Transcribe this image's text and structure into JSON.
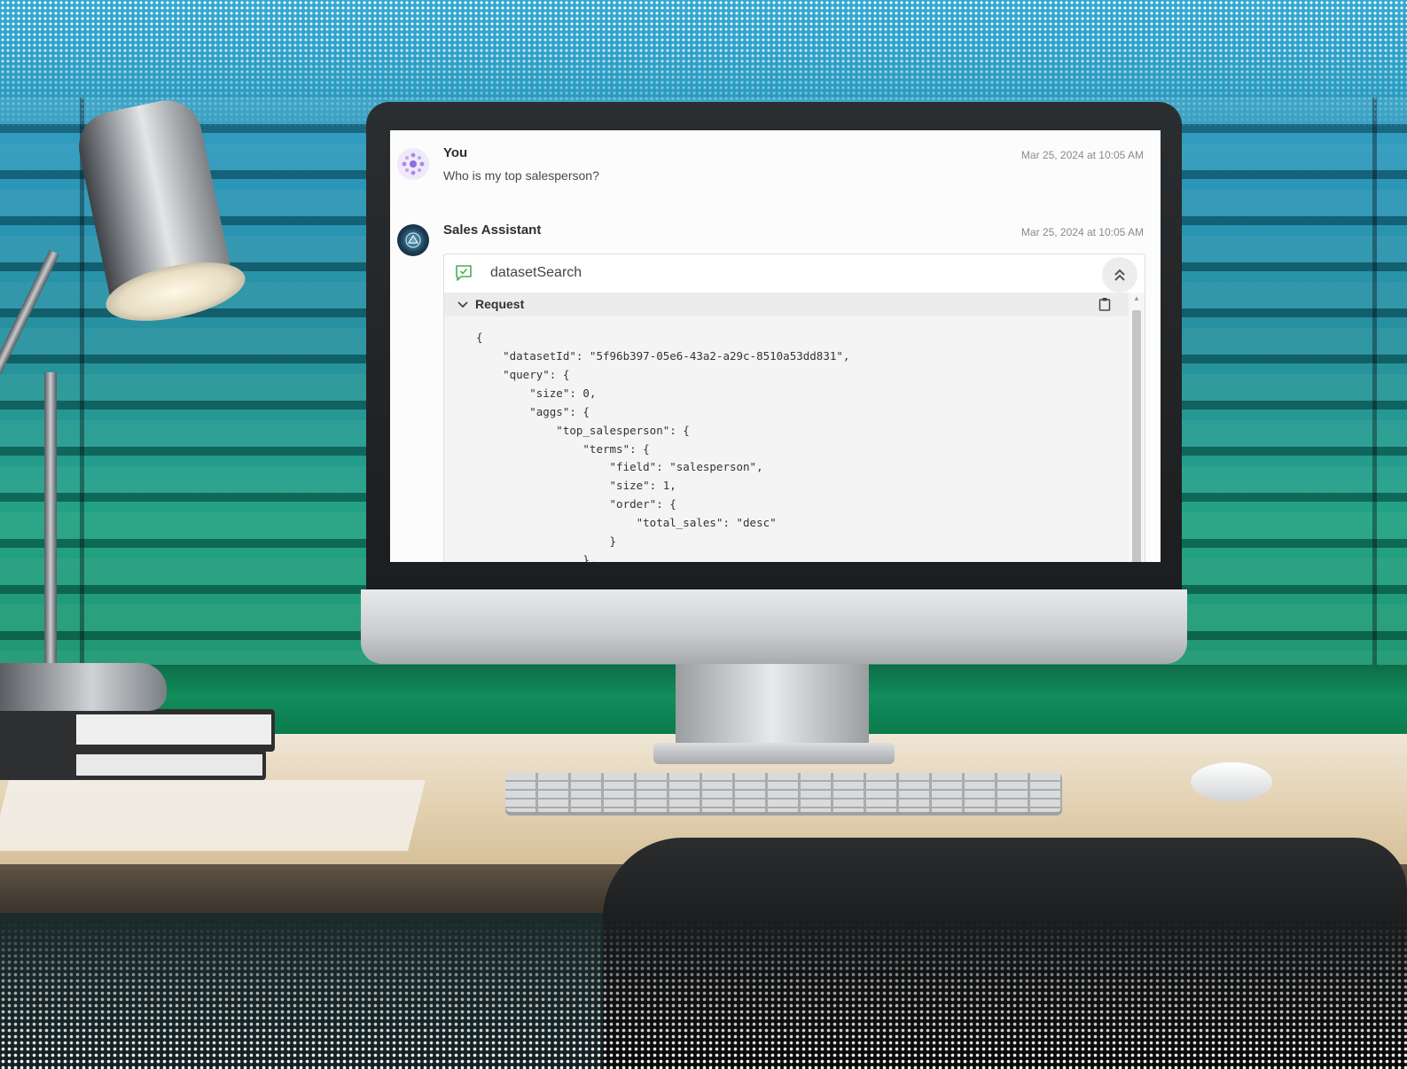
{
  "chat": {
    "messages": [
      {
        "sender": "You",
        "timestamp": "Mar 25, 2024 at 10:05 AM",
        "text": "Who is my top salesperson?",
        "avatar_icon": "user-avatar-icon"
      },
      {
        "sender": "Sales Assistant",
        "timestamp": "Mar 25, 2024 at 10:05 AM",
        "avatar_icon": "assistant-avatar-icon",
        "tool_call": {
          "name": "datasetSearch",
          "icon": "chat-check-icon",
          "section_label": "Request",
          "code_lines": [
            "{",
            "    \"datasetId\": \"5f96b397-05e6-43a2-a29c-8510a53dd831\",",
            "    \"query\": {",
            "        \"size\": 0,",
            "        \"aggs\": {",
            "            \"top_salesperson\": {",
            "                \"terms\": {",
            "                    \"field\": \"salesperson\",",
            "                    \"size\": 1,",
            "                    \"order\": {",
            "                        \"total_sales\": \"desc\"",
            "                    }",
            "                },"
          ]
        }
      }
    ]
  },
  "colors": {
    "tool_icon": "#4caf50",
    "user_avatar": "#8a6fd8",
    "screen_bg": "#fcfcfc",
    "code_bg": "#f4f4f4"
  }
}
